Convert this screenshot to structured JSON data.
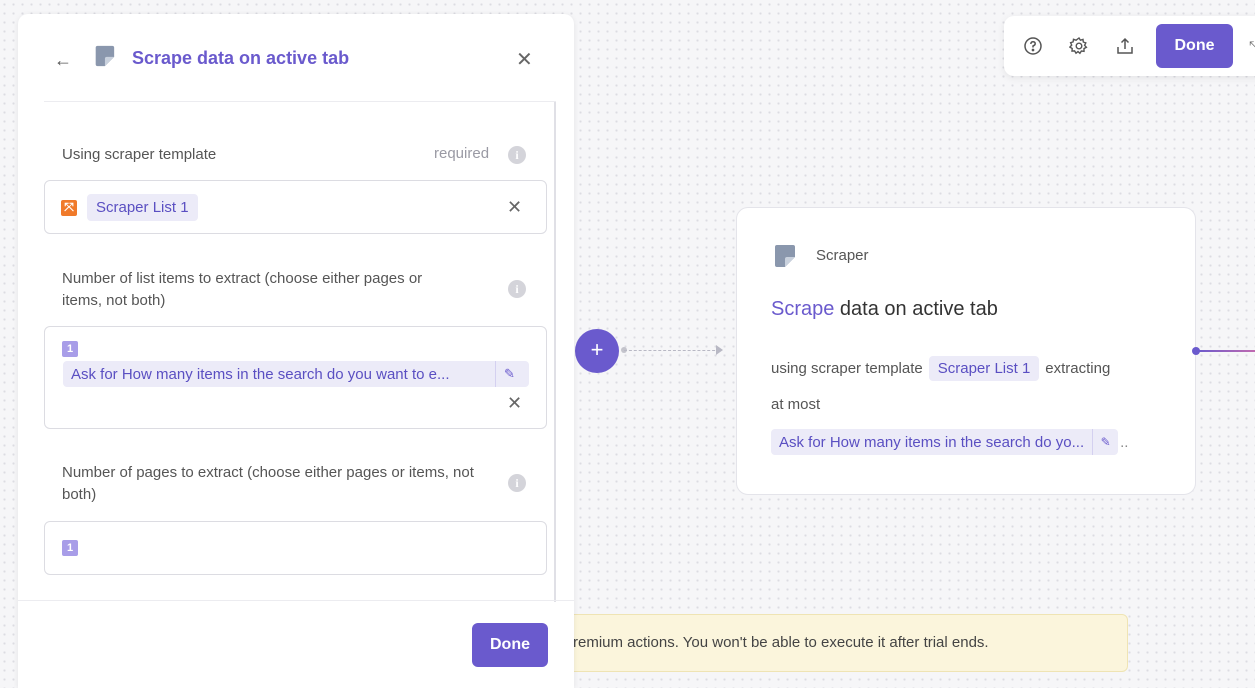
{
  "toolbar": {
    "icons": [
      "help-icon",
      "gear-icon",
      "share-icon"
    ],
    "done_label": "Done",
    "collapse_icon": "collapse-icon"
  },
  "panel": {
    "title": "Scrape data on active tab",
    "fields": [
      {
        "label": "Using scraper template",
        "required_label": "required",
        "value_chip": "Scraper List 1"
      },
      {
        "label": "Number of list items to extract (choose either pages or items, not both)",
        "badge": "1",
        "ask_text": "Ask for How many items in the search do you want to e..."
      },
      {
        "label": "Number of pages to extract (choose either pages or items, not both)",
        "badge": "1"
      }
    ],
    "done_label": "Done"
  },
  "node": {
    "app_name": "Scraper",
    "title_highlight": "Scrape",
    "title_rest": " data on active tab",
    "line1_prefix": "using scraper template",
    "line1_chip": "Scraper List 1",
    "line1_suffix": "extracting",
    "line2": "at most",
    "ask_text": "Ask for How many items in the search do yo...",
    "ask_trailing": ".."
  },
  "warning": {
    "text": "remium actions. You won't be able to execute it after trial ends."
  },
  "colors": {
    "accent": "#6a5acd",
    "chip_bg": "#ecebf8",
    "warning_bg": "#fbf5dc"
  }
}
